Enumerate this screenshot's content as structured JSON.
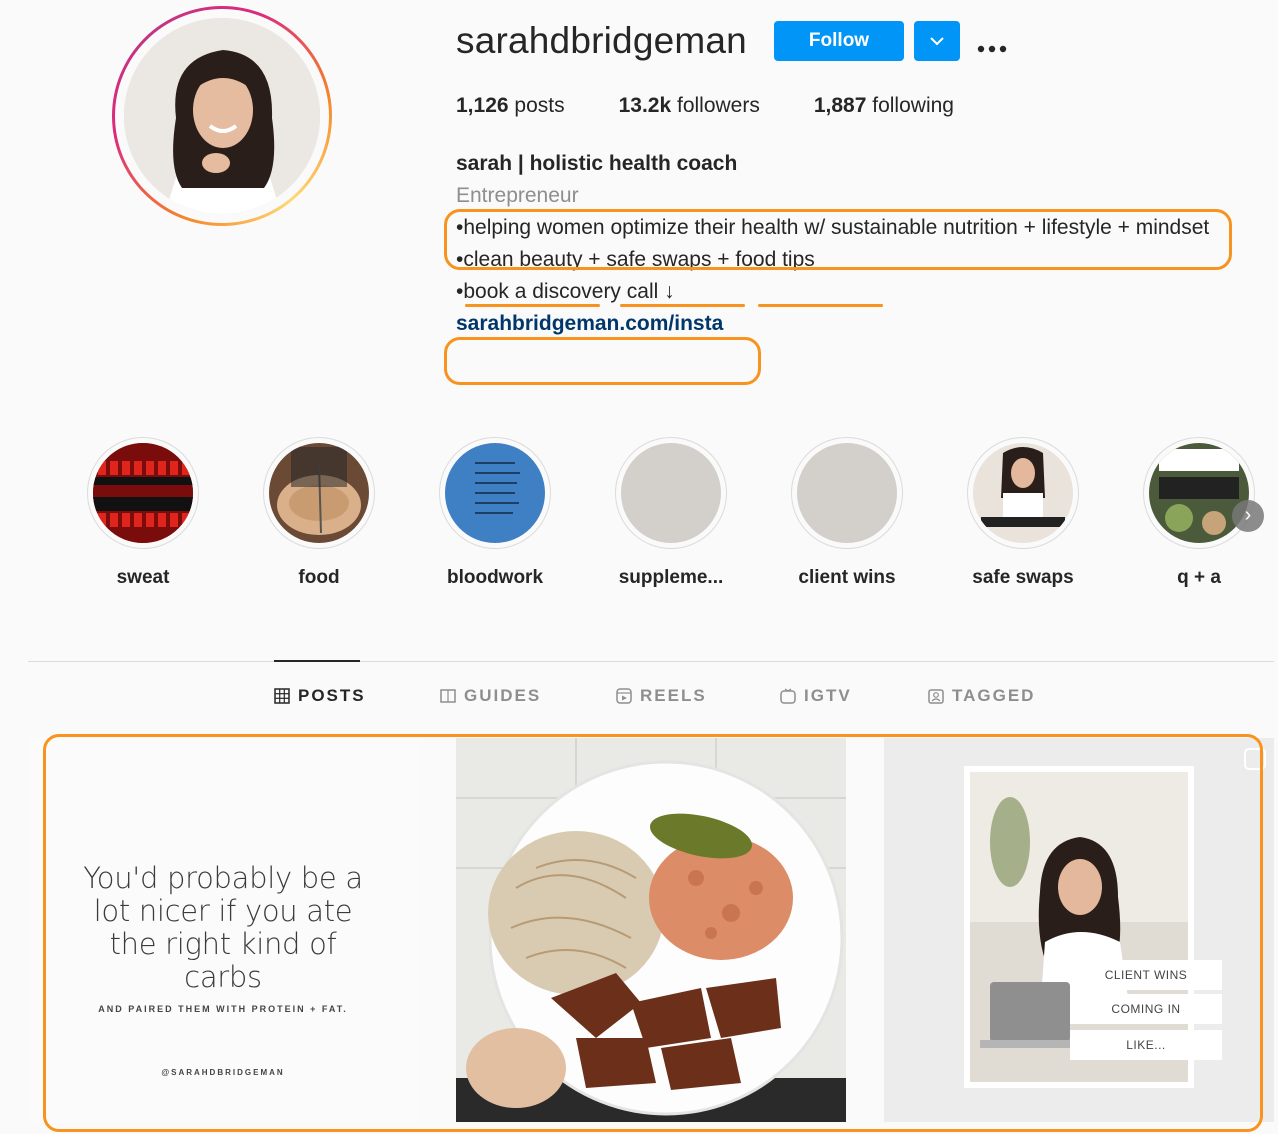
{
  "profile": {
    "username": "sarahdbridgeman",
    "follow_label": "Follow",
    "more_icon": "more-options-icon",
    "stats": {
      "posts_count": "1,126",
      "posts_label": " posts",
      "followers_count": "13.2k",
      "followers_label": " followers",
      "following_count": "1,887",
      "following_label": " following"
    },
    "bio": {
      "name": "sarah | holistic health coach",
      "category": "Entrepreneur",
      "line1": "•helping women optimize their health w/ sustainable nutrition + lifestyle + mindset",
      "line2_prefix": "•",
      "line2_a": "clean beauty",
      "line2_sep1": " + ",
      "line2_b": "safe swaps",
      "line2_sep2": " + ",
      "line2_c": "food tips",
      "line3": "•book a discovery call ↓",
      "link": "sarahbridgeman.com/insta"
    }
  },
  "highlights": [
    {
      "label": "sweat"
    },
    {
      "label": "food"
    },
    {
      "label": "bloodwork"
    },
    {
      "label": "suppleme..."
    },
    {
      "label": "client wins"
    },
    {
      "label": "safe swaps"
    },
    {
      "label": "q + a"
    }
  ],
  "tabs": [
    {
      "label": "POSTS",
      "icon": "grid-icon",
      "active": true
    },
    {
      "label": "GUIDES",
      "icon": "guides-icon"
    },
    {
      "label": "REELS",
      "icon": "reels-icon"
    },
    {
      "label": "IGTV",
      "icon": "igtv-icon"
    },
    {
      "label": "TAGGED",
      "icon": "tagged-icon"
    }
  ],
  "posts": {
    "quote": {
      "line1": "You'd probably be a",
      "line2": "lot nicer if you ate",
      "line3": "the right kind of",
      "line4": "carbs",
      "sub": "AND PAIRED THEM WITH PROTEIN + FAT.",
      "handle": "@SARAHDBRIDGEMAN"
    },
    "client_wins": {
      "label1": "CLIENT WINS",
      "label2": "COMING IN",
      "label3": "LIKE..."
    }
  },
  "colors": {
    "follow": "#0095f6",
    "annotation": "#f7931e",
    "link": "#00376b"
  }
}
